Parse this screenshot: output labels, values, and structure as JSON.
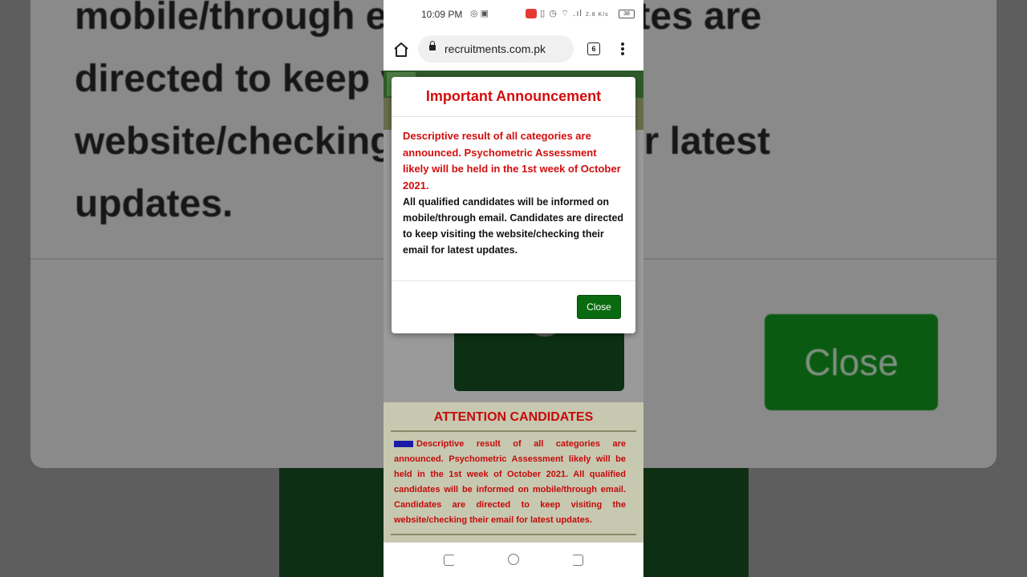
{
  "background": {
    "zoomed_text": "mobile/through email. Candidates are directed to keep visiting the website/checking their email for latest updates.",
    "zoomed_close_label": "Close"
  },
  "status_bar": {
    "time": "10:09 PM",
    "net_speed": "2.8 K/s",
    "battery": "38"
  },
  "browser": {
    "url": "recruitments.com.pk",
    "tab_count": "6"
  },
  "page": {
    "attention_title": "ATTENTION CANDIDATES",
    "attention_body": "Descriptive result of all categories are announced. Psychometric Assessment likely will be held in the 1st week of October 2021. All qualified candidates will be informed on mobile/through email. Candidates are directed to keep visiting the website/checking their email for latest updates."
  },
  "modal": {
    "title": "Important Announcement",
    "highlight_text": "Descriptive result of all categories are announced. Psychometric Assessment likely will be held in the 1st week of October 2021.",
    "body_text": "All qualified candidates will be informed on mobile/through email. Candidates are directed to keep visiting the website/checking their email for latest updates.",
    "close_label": "Close"
  },
  "colors": {
    "accent_red": "#d40d0d",
    "button_green": "#0a6a10"
  }
}
